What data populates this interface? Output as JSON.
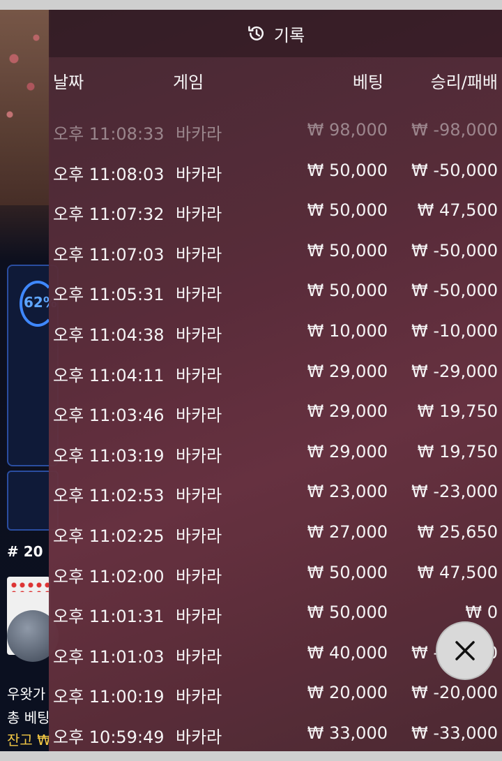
{
  "background": {
    "percent_badge": "62%",
    "round_label": "# 20",
    "bottom_texts": [
      "우왓가",
      "총 베팅",
      "잔고 ₩"
    ]
  },
  "history": {
    "title": "기록",
    "columns": [
      "날짜",
      "게임",
      "베팅",
      "승리/패배"
    ],
    "rows": [
      {
        "time": "오후 11:08:33",
        "game": "바카라",
        "bet": "₩ 98,000",
        "result": "₩ -98,000"
      },
      {
        "time": "오후 11:08:03",
        "game": "바카라",
        "bet": "₩ 50,000",
        "result": "₩ -50,000"
      },
      {
        "time": "오후 11:07:32",
        "game": "바카라",
        "bet": "₩ 50,000",
        "result": "₩ 47,500"
      },
      {
        "time": "오후 11:07:03",
        "game": "바카라",
        "bet": "₩ 50,000",
        "result": "₩ -50,000"
      },
      {
        "time": "오후 11:05:31",
        "game": "바카라",
        "bet": "₩ 50,000",
        "result": "₩ -50,000"
      },
      {
        "time": "오후 11:04:38",
        "game": "바카라",
        "bet": "₩ 10,000",
        "result": "₩ -10,000"
      },
      {
        "time": "오후 11:04:11",
        "game": "바카라",
        "bet": "₩ 29,000",
        "result": "₩ -29,000"
      },
      {
        "time": "오후 11:03:46",
        "game": "바카라",
        "bet": "₩ 29,000",
        "result": "₩ 19,750"
      },
      {
        "time": "오후 11:03:19",
        "game": "바카라",
        "bet": "₩ 29,000",
        "result": "₩ 19,750"
      },
      {
        "time": "오후 11:02:53",
        "game": "바카라",
        "bet": "₩ 23,000",
        "result": "₩ -23,000"
      },
      {
        "time": "오후 11:02:25",
        "game": "바카라",
        "bet": "₩ 27,000",
        "result": "₩ 25,650"
      },
      {
        "time": "오후 11:02:00",
        "game": "바카라",
        "bet": "₩ 50,000",
        "result": "₩ 47,500"
      },
      {
        "time": "오후 11:01:31",
        "game": "바카라",
        "bet": "₩ 50,000",
        "result": "₩ 0"
      },
      {
        "time": "오후 11:01:03",
        "game": "바카라",
        "bet": "₩ 40,000",
        "result": "₩ -40,000"
      },
      {
        "time": "오후 11:00:19",
        "game": "바카라",
        "bet": "₩ 20,000",
        "result": "₩ -20,000"
      },
      {
        "time": "오후 10:59:49",
        "game": "바카라",
        "bet": "₩ 33,000",
        "result": "₩ -33,000"
      }
    ],
    "close_icon": "close-icon"
  }
}
